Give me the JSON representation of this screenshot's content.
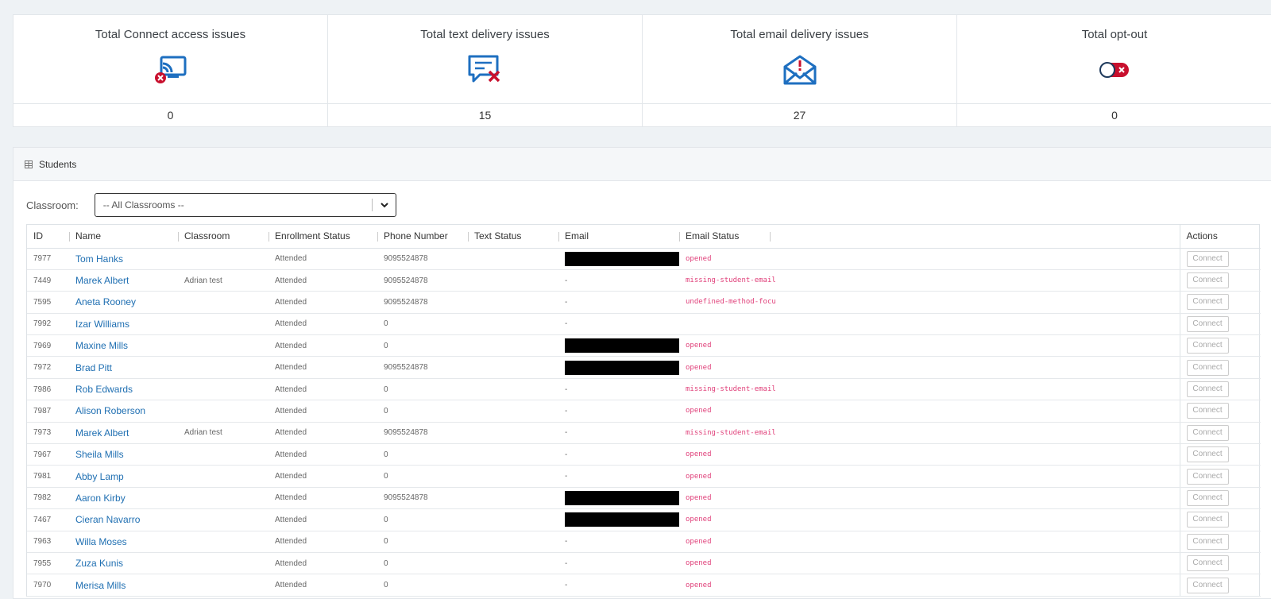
{
  "stats": [
    {
      "title": "Total Connect access issues",
      "value": "0",
      "icon": "cast-error-icon"
    },
    {
      "title": "Total text delivery issues",
      "value": "15",
      "icon": "message-error-icon"
    },
    {
      "title": "Total email delivery issues",
      "value": "27",
      "icon": "envelope-alert-icon"
    },
    {
      "title": "Total opt-out",
      "value": "0",
      "icon": "toggle-off-icon"
    }
  ],
  "panel": {
    "title": "Students",
    "filter_label": "Classroom:",
    "filter_value": "-- All Classrooms --"
  },
  "columns": [
    "ID",
    "Name",
    "Classroom",
    "Enrollment Status",
    "Phone Number",
    "Text Status",
    "Email",
    "Email Status",
    "Actions"
  ],
  "rows": [
    {
      "id": "7977",
      "name": "Tom Hanks",
      "classroom": "",
      "enrollment": "Attended",
      "phone": "9095524878",
      "text": "",
      "email": "",
      "redacted": true,
      "email_status": "opened",
      "action": "Connect"
    },
    {
      "id": "7449",
      "name": "Marek Albert",
      "classroom": "Adrian test",
      "enrollment": "Attended",
      "phone": "9095524878",
      "text": "",
      "email": "-",
      "redacted": false,
      "email_status": "missing-student-email",
      "action": "Connect"
    },
    {
      "id": "7595",
      "name": "Aneta Rooney",
      "classroom": "",
      "enrollment": "Attended",
      "phone": "9095524878",
      "text": "",
      "email": "-",
      "redacted": false,
      "email_status": "undefined-method-focu",
      "action": "Connect"
    },
    {
      "id": "7992",
      "name": "Izar Williams",
      "classroom": "",
      "enrollment": "Attended",
      "phone": "0",
      "text": "",
      "email": "-",
      "redacted": false,
      "email_status": "",
      "action": "Connect"
    },
    {
      "id": "7969",
      "name": "Maxine Mills",
      "classroom": "",
      "enrollment": "Attended",
      "phone": "0",
      "text": "",
      "email": "",
      "redacted": true,
      "email_status": "opened",
      "action": "Connect"
    },
    {
      "id": "7972",
      "name": "Brad Pitt",
      "classroom": "",
      "enrollment": "Attended",
      "phone": "9095524878",
      "text": "",
      "email": "",
      "redacted": true,
      "email_status": "opened",
      "action": "Connect"
    },
    {
      "id": "7986",
      "name": "Rob Edwards",
      "classroom": "",
      "enrollment": "Attended",
      "phone": "0",
      "text": "",
      "email": "-",
      "redacted": false,
      "email_status": "missing-student-email",
      "action": "Connect"
    },
    {
      "id": "7987",
      "name": "Alison Roberson",
      "classroom": "",
      "enrollment": "Attended",
      "phone": "0",
      "text": "",
      "email": "-",
      "redacted": false,
      "email_status": "opened",
      "action": "Connect"
    },
    {
      "id": "7973",
      "name": "Marek Albert",
      "classroom": "Adrian test",
      "enrollment": "Attended",
      "phone": "9095524878",
      "text": "",
      "email": "-",
      "redacted": false,
      "email_status": "missing-student-email",
      "action": "Connect"
    },
    {
      "id": "7967",
      "name": "Sheila Mills",
      "classroom": "",
      "enrollment": "Attended",
      "phone": "0",
      "text": "",
      "email": "-",
      "redacted": false,
      "email_status": "opened",
      "action": "Connect"
    },
    {
      "id": "7981",
      "name": "Abby Lamp",
      "classroom": "",
      "enrollment": "Attended",
      "phone": "0",
      "text": "",
      "email": "-",
      "redacted": false,
      "email_status": "opened",
      "action": "Connect"
    },
    {
      "id": "7982",
      "name": "Aaron Kirby",
      "classroom": "",
      "enrollment": "Attended",
      "phone": "9095524878",
      "text": "",
      "email": "",
      "redacted": true,
      "email_status": "opened",
      "action": "Connect"
    },
    {
      "id": "7467",
      "name": "Cieran Navarro",
      "classroom": "",
      "enrollment": "Attended",
      "phone": "0",
      "text": "",
      "email": "",
      "redacted": true,
      "email_status": "opened",
      "action": "Connect"
    },
    {
      "id": "7963",
      "name": "Willa Moses",
      "classroom": "",
      "enrollment": "Attended",
      "phone": "0",
      "text": "",
      "email": "-",
      "redacted": false,
      "email_status": "opened",
      "action": "Connect"
    },
    {
      "id": "7955",
      "name": "Zuza Kunis",
      "classroom": "",
      "enrollment": "Attended",
      "phone": "0",
      "text": "",
      "email": "-",
      "redacted": false,
      "email_status": "opened",
      "action": "Connect"
    },
    {
      "id": "7970",
      "name": "Merisa Mills",
      "classroom": "",
      "enrollment": "Attended",
      "phone": "0",
      "text": "",
      "email": "-",
      "redacted": false,
      "email_status": "opened",
      "action": "Connect"
    }
  ],
  "colors": {
    "link": "#1f6fb2",
    "status": "#e0407a",
    "icon_blue": "#1e6fc0",
    "icon_red": "#c8102e"
  }
}
